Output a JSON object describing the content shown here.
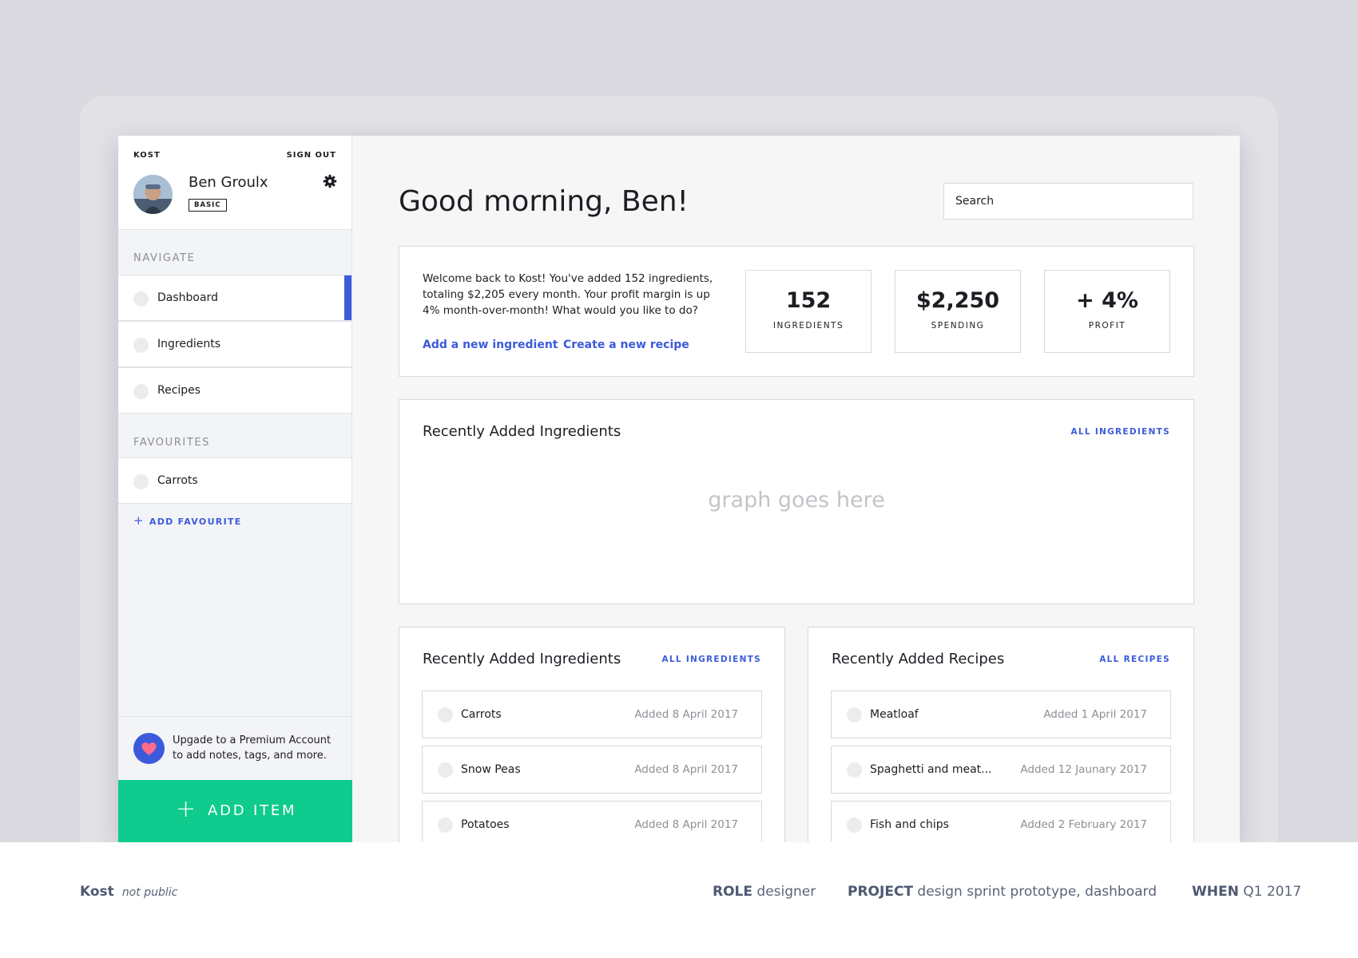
{
  "sidebar": {
    "brand": "KOST",
    "sign_out": "SIGN OUT",
    "user_name": "Ben Groulx",
    "plan_badge": "BASIC",
    "navigate_label": "NAVIGATE",
    "nav_items": [
      {
        "label": "Dashboard",
        "active": true,
        "icon": "circle-icon"
      },
      {
        "label": "Ingredients",
        "active": false,
        "icon": "circle-icon"
      },
      {
        "label": "Recipes",
        "active": false,
        "icon": "circle-icon"
      }
    ],
    "favourites_label": "FAVOURITES",
    "favourites": [
      {
        "label": "Carrots",
        "icon": "circle-icon"
      }
    ],
    "add_favourite": "ADD FAVOURITE",
    "upgrade_text": "Upgade to a Premium Account to add notes, tags, and more.",
    "add_item": "ADD ITEM"
  },
  "header": {
    "greeting": "Good morning, Ben!",
    "search_placeholder": "Search"
  },
  "welcome": {
    "text": "Welcome back to Kost! You've added 152 ingredients, totaling $2,205 every month. Your profit margin is up 4% month-over-month! What would you like to do?",
    "link_add_ingredient": "Add a new ingredient",
    "link_create_recipe": "Create a new recipe",
    "stats": [
      {
        "value": "152",
        "label": "INGREDIENTS"
      },
      {
        "value": "$2,250",
        "label": "SPENDING"
      },
      {
        "value": "+ 4%",
        "label": "PROFIT"
      }
    ]
  },
  "graph_card": {
    "title": "Recently Added Ingredients",
    "link": "ALL INGREDIENTS",
    "placeholder": "graph goes here"
  },
  "ingredients_card": {
    "title": "Recently Added Ingredients",
    "link": "ALL INGREDIENTS",
    "rows": [
      {
        "name": "Carrots",
        "date": "Added 8 April 2017"
      },
      {
        "name": "Snow Peas",
        "date": "Added 8 April 2017"
      },
      {
        "name": "Potatoes",
        "date": "Added 8 April 2017"
      }
    ]
  },
  "recipes_card": {
    "title": "Recently Added Recipes",
    "link": "ALL RECIPES",
    "rows": [
      {
        "name": "Meatloaf",
        "date": "Added 1 April 2017"
      },
      {
        "name": "Spaghetti and meat...",
        "date": "Added 12 Jaunary 2017"
      },
      {
        "name": "Fish and chips",
        "date": "Added 2 February 2017"
      }
    ]
  },
  "footer": {
    "project_name": "Kost",
    "visibility": "not public",
    "role_key": "ROLE",
    "role_value": "designer",
    "project_key": "PROJECT",
    "project_value": "design sprint prototype, dashboard",
    "when_key": "WHEN",
    "when_value": "Q1 2017"
  },
  "colors": {
    "accent": "#3b5bdb",
    "add_item_green": "#0fcb8d",
    "heart_pink": "#ff6b8b"
  }
}
